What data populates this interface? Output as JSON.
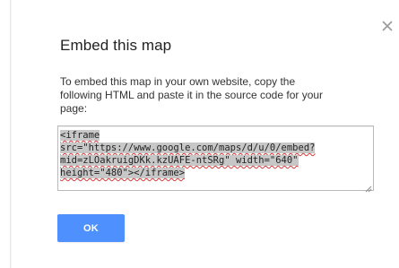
{
  "dialog": {
    "title": "Embed this map",
    "description": "To embed this map in your own website, copy the following HTML and paste it in the source code for your page:",
    "embed_code_lines": [
      "<iframe",
      "src=\"https://www.google.com/maps/d/u/0/embed?",
      "mid=zLOakruigDKk.kzUAFE-ntSRg\" width=\"640\"",
      "height=\"480\"></iframe>"
    ],
    "ok_label": "OK",
    "close_icon": "close-icon"
  },
  "colors": {
    "ok_button": "#4d90fe",
    "selection_highlight": "#c7c7c7",
    "spellcheck_underline": "#d93a3a",
    "title_text": "#222222"
  }
}
